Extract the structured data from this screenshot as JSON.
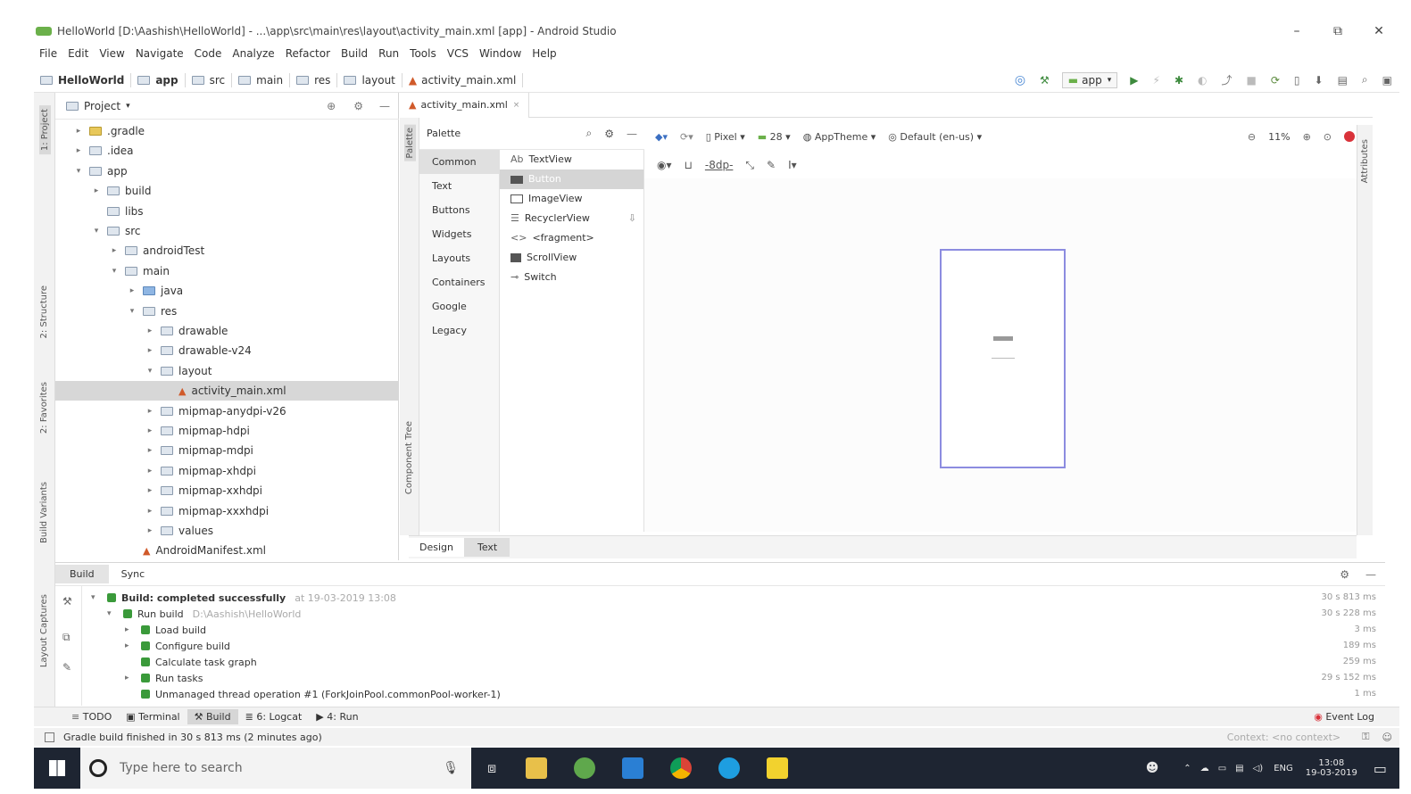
{
  "window": {
    "title": "HelloWorld [D:\\Aashish\\HelloWorld] - ...\\app\\src\\main\\res\\layout\\activity_main.xml [app] - Android Studio",
    "minimize": "–",
    "restore": "⧉",
    "close": "✕"
  },
  "menu": [
    "File",
    "Edit",
    "View",
    "Navigate",
    "Code",
    "Analyze",
    "Refactor",
    "Build",
    "Run",
    "Tools",
    "VCS",
    "Window",
    "Help"
  ],
  "breadcrumbs": [
    "HelloWorld",
    "app",
    "src",
    "main",
    "res",
    "layout",
    "activity_main.xml"
  ],
  "toolbar": {
    "run_config": "app"
  },
  "left_tools": [
    "1: Project",
    "2: Structure",
    "2: Favorites",
    "Build Variants",
    "Layout Captures"
  ],
  "project_panel": {
    "header": "Project",
    "tree": [
      {
        "label": ".gradle",
        "depth": 1,
        "arrow": "▸",
        "folder": "yellow"
      },
      {
        "label": ".idea",
        "depth": 1,
        "arrow": "▸",
        "folder": "plain"
      },
      {
        "label": "app",
        "depth": 1,
        "arrow": "▾",
        "folder": "plain"
      },
      {
        "label": "build",
        "depth": 2,
        "arrow": "▸",
        "folder": "plain"
      },
      {
        "label": "libs",
        "depth": 2,
        "arrow": "",
        "folder": "plain"
      },
      {
        "label": "src",
        "depth": 2,
        "arrow": "▾",
        "folder": "plain"
      },
      {
        "label": "androidTest",
        "depth": 3,
        "arrow": "▸",
        "folder": "plain"
      },
      {
        "label": "main",
        "depth": 3,
        "arrow": "▾",
        "folder": "plain"
      },
      {
        "label": "java",
        "depth": 4,
        "arrow": "▸",
        "folder": "blue"
      },
      {
        "label": "res",
        "depth": 4,
        "arrow": "▾",
        "folder": "plain"
      },
      {
        "label": "drawable",
        "depth": 5,
        "arrow": "▸",
        "folder": "plain"
      },
      {
        "label": "drawable-v24",
        "depth": 5,
        "arrow": "▸",
        "folder": "plain"
      },
      {
        "label": "layout",
        "depth": 5,
        "arrow": "▾",
        "folder": "plain"
      },
      {
        "label": "activity_main.xml",
        "depth": 6,
        "arrow": "",
        "folder": "file",
        "selected": true
      },
      {
        "label": "mipmap-anydpi-v26",
        "depth": 5,
        "arrow": "▸",
        "folder": "plain"
      },
      {
        "label": "mipmap-hdpi",
        "depth": 5,
        "arrow": "▸",
        "folder": "plain"
      },
      {
        "label": "mipmap-mdpi",
        "depth": 5,
        "arrow": "▸",
        "folder": "plain"
      },
      {
        "label": "mipmap-xhdpi",
        "depth": 5,
        "arrow": "▸",
        "folder": "plain"
      },
      {
        "label": "mipmap-xxhdpi",
        "depth": 5,
        "arrow": "▸",
        "folder": "plain"
      },
      {
        "label": "mipmap-xxxhdpi",
        "depth": 5,
        "arrow": "▸",
        "folder": "plain"
      },
      {
        "label": "values",
        "depth": 5,
        "arrow": "▸",
        "folder": "plain"
      },
      {
        "label": "AndroidManifest.xml",
        "depth": 4,
        "arrow": "",
        "folder": "file"
      }
    ]
  },
  "editor": {
    "tab": "activity_main.xml",
    "palette_title": "Palette",
    "palette_categories": [
      "Common",
      "Text",
      "Buttons",
      "Widgets",
      "Layouts",
      "Containers",
      "Google",
      "Legacy"
    ],
    "palette_items": [
      "TextView",
      "Button",
      "ImageView",
      "RecyclerView",
      "<fragment>",
      "ScrollView",
      "Switch"
    ],
    "device": "Pixel",
    "api": "28",
    "theme": "AppTheme",
    "locale": "Default (en-us)",
    "zoom": "11%",
    "side_tabs": [
      "Palette",
      "Component Tree"
    ],
    "right_tabs": [
      "Attributes"
    ],
    "design_tabs": [
      "Design",
      "Text"
    ]
  },
  "build_panel": {
    "tabs": [
      "Build",
      "Sync"
    ],
    "rows": [
      {
        "label": "Build: completed successfully",
        "suffix": "at 19-03-2019 13:08",
        "time": "30 s 813 ms",
        "depth": 0
      },
      {
        "label": "Run build",
        "suffix": "D:\\Aashish\\HelloWorld",
        "time": "30 s 228 ms",
        "depth": 1
      },
      {
        "label": "Load build",
        "suffix": "",
        "time": "3 ms",
        "depth": 2
      },
      {
        "label": "Configure build",
        "suffix": "",
        "time": "189 ms",
        "depth": 2
      },
      {
        "label": "Calculate task graph",
        "suffix": "",
        "time": "259 ms",
        "depth": 2
      },
      {
        "label": "Run tasks",
        "suffix": "",
        "time": "29 s 152 ms",
        "depth": 2
      },
      {
        "label": "Unmanaged thread operation #1 (ForkJoinPool.commonPool-worker-1)",
        "suffix": "",
        "time": "1 ms",
        "depth": 1
      }
    ]
  },
  "tool_tabs": [
    "TODO",
    "Terminal",
    "Build",
    "6: Logcat",
    "4: Run"
  ],
  "event_log": "Event Log",
  "status": {
    "message": "Gradle build finished in 30 s 813 ms (2 minutes ago)",
    "context": "Context: <no context>"
  },
  "taskbar": {
    "search_placeholder": "Type here to search",
    "lang": "ENG",
    "time": "13:08",
    "date": "19-03-2019"
  }
}
